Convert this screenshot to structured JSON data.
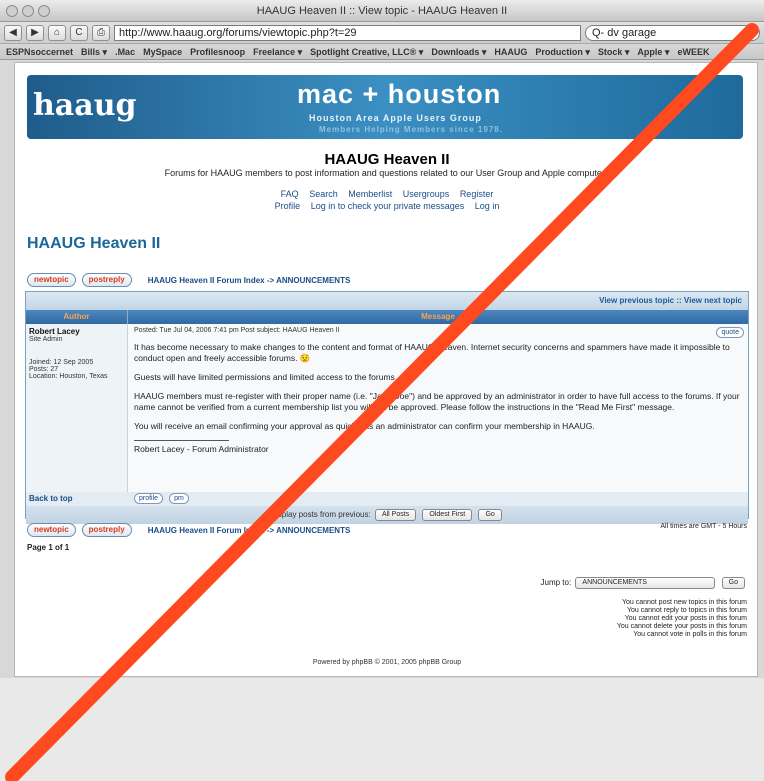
{
  "window": {
    "title": "HAAUG Heaven II :: View topic - HAAUG Heaven II"
  },
  "toolbar": {
    "back": "◀",
    "forward": "▶",
    "home": "⌂",
    "reload": "C",
    "print": "⎙",
    "url": "http://www.haaug.org/forums/viewtopic.php?t=29",
    "search": "Q- dv garage"
  },
  "bookmarks": [
    "ESPNsoccernet",
    "Bills ▾",
    ".Mac",
    "MySpace",
    "Profilesnoop",
    "Freelance ▾",
    "Spotlight Creative, LLC® ▾",
    "Downloads ▾",
    "HAAUG",
    "Production ▾",
    "Stock ▾",
    "Apple ▾",
    "eWEEK"
  ],
  "banner": {
    "logo": "haaug",
    "title": "mac + houston",
    "subtitle": "Houston Area Apple Users Group",
    "tagline": "Members Helping Members since 1978."
  },
  "site": {
    "title": "HAAUG Heaven II",
    "description": "Forums for HAAUG members to post information and questions related to our User Group and Apple computers"
  },
  "nav1": [
    "FAQ",
    "Search",
    "Memberlist",
    "Usergroups",
    "Register"
  ],
  "nav2": [
    "Profile",
    "Log in to check your private messages",
    "Log in"
  ],
  "forum_heading": "HAAUG Heaven II",
  "buttons": {
    "new_topic": "newtopic",
    "post_reply": "postreply"
  },
  "breadcrumb": "HAAUG Heaven II Forum Index -> ANNOUNCEMENTS",
  "table": {
    "topic_nav": "View previous topic :: View next topic",
    "col_author": "Author",
    "col_message": "Message",
    "author": {
      "name": "Robert Lacey",
      "role": "Site Admin",
      "joined": "Joined: 12 Sep 2005",
      "posts": "Posts: 27",
      "location": "Location: Houston, Texas"
    },
    "post": {
      "header": "Posted: Tue Jul 04, 2006 7:41 pm    Post subject: HAAUG Heaven II",
      "quote": "quote",
      "p1": "It has become necessary to make changes to the content and format of HAAUG Heaven. Internet security concerns and spammers have made it impossible to conduct open and freely accessible forums. 😟",
      "p2": "Guests will have limited permissions and limited access to the forums.",
      "p3": "HAAUG members must re-register with their proper name (i.e. \"Jane Doe\") and be approved by an administrator in order to have full access to the forums. If your name cannot be verified from a current membership list you will not be approved. Please follow the instructions in the \"Read Me First\" message.",
      "p4": "You will receive an email confirming your approval as quickly as an administrator can confirm your membership in HAAUG.",
      "signature": "Robert Lacey - Forum Administrator"
    },
    "back_to_top": "Back to top",
    "profile_btn": "profile",
    "pm_btn": "pm",
    "display_label": "Display posts from previous:",
    "display_select": "All Posts",
    "order_select": "Oldest First",
    "go": "Go"
  },
  "timezone": "All times are GMT - 5 Hours",
  "page": "Page 1 of 1",
  "jump": {
    "label": "Jump to:",
    "value": "ANNOUNCEMENTS",
    "go": "Go"
  },
  "permissions": [
    "You cannot post new topics in this forum",
    "You cannot reply to topics in this forum",
    "You cannot edit your posts in this forum",
    "You cannot delete your posts in this forum",
    "You cannot vote in polls in this forum"
  ],
  "powered": "Powered by phpBB © 2001, 2005 phpBB Group",
  "colors": {
    "slash": "#ff4a1f",
    "link": "#1a4d8a",
    "heading": "#1b6898"
  }
}
